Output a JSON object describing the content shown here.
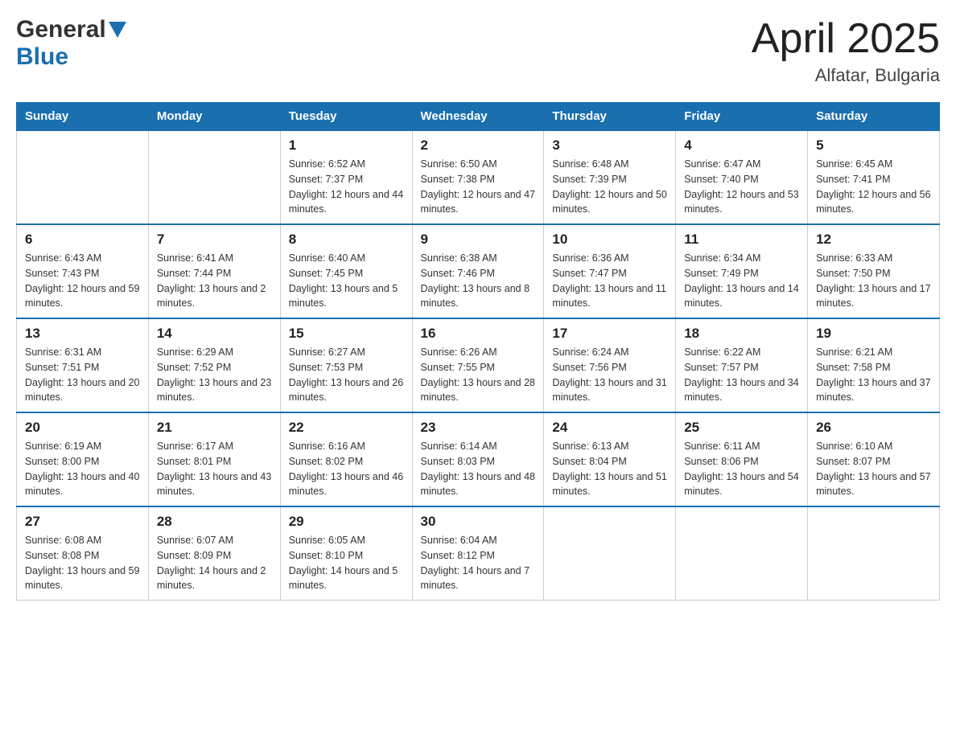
{
  "header": {
    "logo_general": "General",
    "logo_blue": "Blue",
    "title": "April 2025",
    "subtitle": "Alfatar, Bulgaria"
  },
  "days_of_week": [
    "Sunday",
    "Monday",
    "Tuesday",
    "Wednesday",
    "Thursday",
    "Friday",
    "Saturday"
  ],
  "weeks": [
    [
      {
        "day": "",
        "sunrise": "",
        "sunset": "",
        "daylight": ""
      },
      {
        "day": "",
        "sunrise": "",
        "sunset": "",
        "daylight": ""
      },
      {
        "day": "1",
        "sunrise": "Sunrise: 6:52 AM",
        "sunset": "Sunset: 7:37 PM",
        "daylight": "Daylight: 12 hours and 44 minutes."
      },
      {
        "day": "2",
        "sunrise": "Sunrise: 6:50 AM",
        "sunset": "Sunset: 7:38 PM",
        "daylight": "Daylight: 12 hours and 47 minutes."
      },
      {
        "day": "3",
        "sunrise": "Sunrise: 6:48 AM",
        "sunset": "Sunset: 7:39 PM",
        "daylight": "Daylight: 12 hours and 50 minutes."
      },
      {
        "day": "4",
        "sunrise": "Sunrise: 6:47 AM",
        "sunset": "Sunset: 7:40 PM",
        "daylight": "Daylight: 12 hours and 53 minutes."
      },
      {
        "day": "5",
        "sunrise": "Sunrise: 6:45 AM",
        "sunset": "Sunset: 7:41 PM",
        "daylight": "Daylight: 12 hours and 56 minutes."
      }
    ],
    [
      {
        "day": "6",
        "sunrise": "Sunrise: 6:43 AM",
        "sunset": "Sunset: 7:43 PM",
        "daylight": "Daylight: 12 hours and 59 minutes."
      },
      {
        "day": "7",
        "sunrise": "Sunrise: 6:41 AM",
        "sunset": "Sunset: 7:44 PM",
        "daylight": "Daylight: 13 hours and 2 minutes."
      },
      {
        "day": "8",
        "sunrise": "Sunrise: 6:40 AM",
        "sunset": "Sunset: 7:45 PM",
        "daylight": "Daylight: 13 hours and 5 minutes."
      },
      {
        "day": "9",
        "sunrise": "Sunrise: 6:38 AM",
        "sunset": "Sunset: 7:46 PM",
        "daylight": "Daylight: 13 hours and 8 minutes."
      },
      {
        "day": "10",
        "sunrise": "Sunrise: 6:36 AM",
        "sunset": "Sunset: 7:47 PM",
        "daylight": "Daylight: 13 hours and 11 minutes."
      },
      {
        "day": "11",
        "sunrise": "Sunrise: 6:34 AM",
        "sunset": "Sunset: 7:49 PM",
        "daylight": "Daylight: 13 hours and 14 minutes."
      },
      {
        "day": "12",
        "sunrise": "Sunrise: 6:33 AM",
        "sunset": "Sunset: 7:50 PM",
        "daylight": "Daylight: 13 hours and 17 minutes."
      }
    ],
    [
      {
        "day": "13",
        "sunrise": "Sunrise: 6:31 AM",
        "sunset": "Sunset: 7:51 PM",
        "daylight": "Daylight: 13 hours and 20 minutes."
      },
      {
        "day": "14",
        "sunrise": "Sunrise: 6:29 AM",
        "sunset": "Sunset: 7:52 PM",
        "daylight": "Daylight: 13 hours and 23 minutes."
      },
      {
        "day": "15",
        "sunrise": "Sunrise: 6:27 AM",
        "sunset": "Sunset: 7:53 PM",
        "daylight": "Daylight: 13 hours and 26 minutes."
      },
      {
        "day": "16",
        "sunrise": "Sunrise: 6:26 AM",
        "sunset": "Sunset: 7:55 PM",
        "daylight": "Daylight: 13 hours and 28 minutes."
      },
      {
        "day": "17",
        "sunrise": "Sunrise: 6:24 AM",
        "sunset": "Sunset: 7:56 PM",
        "daylight": "Daylight: 13 hours and 31 minutes."
      },
      {
        "day": "18",
        "sunrise": "Sunrise: 6:22 AM",
        "sunset": "Sunset: 7:57 PM",
        "daylight": "Daylight: 13 hours and 34 minutes."
      },
      {
        "day": "19",
        "sunrise": "Sunrise: 6:21 AM",
        "sunset": "Sunset: 7:58 PM",
        "daylight": "Daylight: 13 hours and 37 minutes."
      }
    ],
    [
      {
        "day": "20",
        "sunrise": "Sunrise: 6:19 AM",
        "sunset": "Sunset: 8:00 PM",
        "daylight": "Daylight: 13 hours and 40 minutes."
      },
      {
        "day": "21",
        "sunrise": "Sunrise: 6:17 AM",
        "sunset": "Sunset: 8:01 PM",
        "daylight": "Daylight: 13 hours and 43 minutes."
      },
      {
        "day": "22",
        "sunrise": "Sunrise: 6:16 AM",
        "sunset": "Sunset: 8:02 PM",
        "daylight": "Daylight: 13 hours and 46 minutes."
      },
      {
        "day": "23",
        "sunrise": "Sunrise: 6:14 AM",
        "sunset": "Sunset: 8:03 PM",
        "daylight": "Daylight: 13 hours and 48 minutes."
      },
      {
        "day": "24",
        "sunrise": "Sunrise: 6:13 AM",
        "sunset": "Sunset: 8:04 PM",
        "daylight": "Daylight: 13 hours and 51 minutes."
      },
      {
        "day": "25",
        "sunrise": "Sunrise: 6:11 AM",
        "sunset": "Sunset: 8:06 PM",
        "daylight": "Daylight: 13 hours and 54 minutes."
      },
      {
        "day": "26",
        "sunrise": "Sunrise: 6:10 AM",
        "sunset": "Sunset: 8:07 PM",
        "daylight": "Daylight: 13 hours and 57 minutes."
      }
    ],
    [
      {
        "day": "27",
        "sunrise": "Sunrise: 6:08 AM",
        "sunset": "Sunset: 8:08 PM",
        "daylight": "Daylight: 13 hours and 59 minutes."
      },
      {
        "day": "28",
        "sunrise": "Sunrise: 6:07 AM",
        "sunset": "Sunset: 8:09 PM",
        "daylight": "Daylight: 14 hours and 2 minutes."
      },
      {
        "day": "29",
        "sunrise": "Sunrise: 6:05 AM",
        "sunset": "Sunset: 8:10 PM",
        "daylight": "Daylight: 14 hours and 5 minutes."
      },
      {
        "day": "30",
        "sunrise": "Sunrise: 6:04 AM",
        "sunset": "Sunset: 8:12 PM",
        "daylight": "Daylight: 14 hours and 7 minutes."
      },
      {
        "day": "",
        "sunrise": "",
        "sunset": "",
        "daylight": ""
      },
      {
        "day": "",
        "sunrise": "",
        "sunset": "",
        "daylight": ""
      },
      {
        "day": "",
        "sunrise": "",
        "sunset": "",
        "daylight": ""
      }
    ]
  ]
}
